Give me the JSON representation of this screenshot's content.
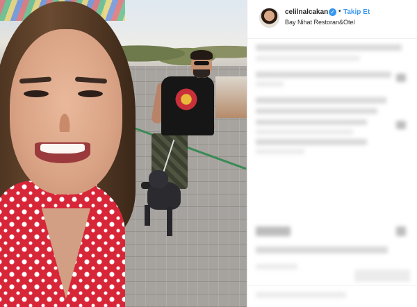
{
  "post": {
    "username": "celilnalcakan",
    "verified_glyph": "✓",
    "separator": "•",
    "follow_label": "Takip Et",
    "location": "Bay Nihat Restoran&Otel"
  },
  "colors": {
    "accent": "#3897f0",
    "text": "#262626",
    "divider": "#efefef"
  },
  "icons": [
    "verified-badge-icon"
  ]
}
